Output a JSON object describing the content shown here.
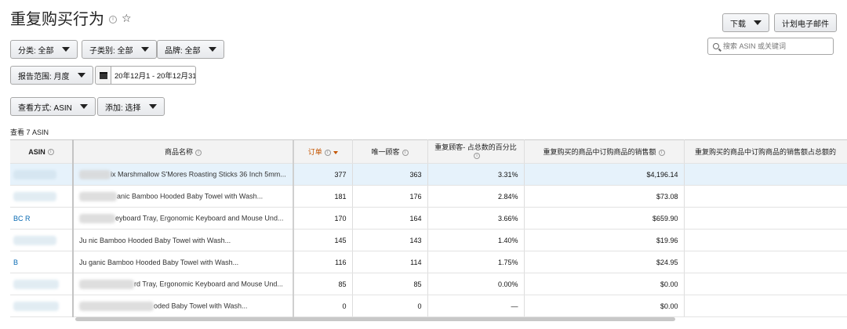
{
  "page": {
    "title": "重复购买行为",
    "info_icon": "info-icon",
    "star_icon": "star-icon"
  },
  "toolbar": {
    "download_label": "下载",
    "schedule_email_label": "计划电子邮件",
    "search_placeholder": "搜索 ASIN 或关键词"
  },
  "filters": {
    "category": "分类: 全部",
    "subcategory": "子类别: 全部",
    "brand": "品牌: 全部",
    "report_range": "报告范围: 月度",
    "date_range": "20年12月1 - 20年12月31",
    "view_by": "查看方式: ASIN",
    "add": "添加: 选择"
  },
  "table": {
    "count_label": "查看 7 ASIN",
    "columns": {
      "asin": "ASIN",
      "product_name": "商品名称",
      "orders": "订单",
      "unique_customers": "唯一顾客",
      "repeat_pct": "重复顾客- 占总数的百分比",
      "repeat_sales": "重复购买的商品中订购商品的销售额",
      "repeat_sales_pct": "重复购买的商品中订购商品的销售额占总额的"
    },
    "rows": [
      {
        "asin": "",
        "name": "ix Marshmallow S'Mores Roasting Sticks 36 Inch 5mm...",
        "orders": "377",
        "unique": "363",
        "pct": "3.31%",
        "sales": "$4,196.14"
      },
      {
        "asin": "",
        "name": "anic Bamboo Hooded Baby Towel with Wash...",
        "orders": "181",
        "unique": "176",
        "pct": "2.84%",
        "sales": "$73.08"
      },
      {
        "asin": "BC R",
        "name": "eyboard Tray, Ergonomic Keyboard and Mouse Und...",
        "orders": "170",
        "unique": "164",
        "pct": "3.66%",
        "sales": "$659.90"
      },
      {
        "asin": "",
        "name": "Ju nic Bamboo Hooded Baby Towel with Wash...",
        "orders": "145",
        "unique": "143",
        "pct": "1.40%",
        "sales": "$19.96"
      },
      {
        "asin": "B",
        "name": "Ju ganic Bamboo Hooded Baby Towel with Wash...",
        "orders": "116",
        "unique": "114",
        "pct": "1.75%",
        "sales": "$24.95"
      },
      {
        "asin": "",
        "name": "rd Tray, Ergonomic Keyboard and Mouse Und...",
        "orders": "85",
        "unique": "85",
        "pct": "0.00%",
        "sales": "$0.00"
      },
      {
        "asin": "",
        "name": "oded Baby Towel with Wash...",
        "orders": "0",
        "unique": "0",
        "pct": "—",
        "sales": "$0.00"
      }
    ]
  }
}
